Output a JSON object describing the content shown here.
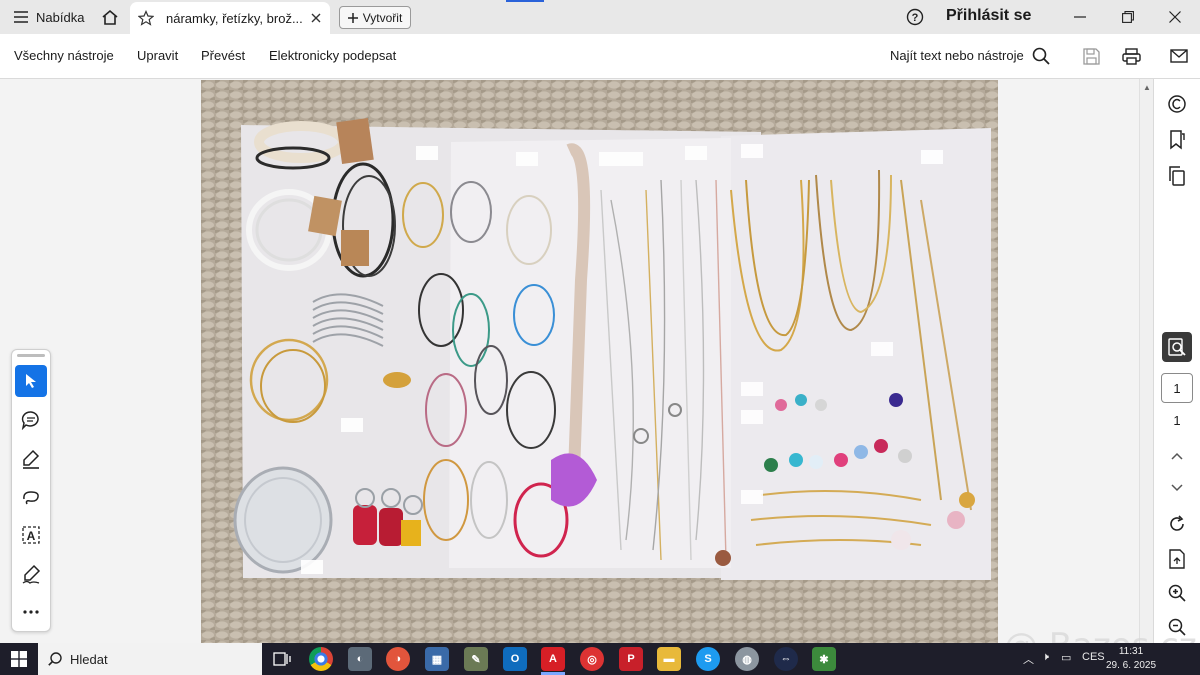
{
  "titlebar": {
    "menu_label": "Nabídka",
    "tab_title": "náramky, řetízky, brož...",
    "create_label": "Vytvořit",
    "signin_label": "Přihlásit se"
  },
  "toolbar": {
    "all_tools": "Všechny nástroje",
    "edit": "Upravit",
    "convert": "Převést",
    "sign": "Elektronicky podepsat",
    "find": "Najít text nebo nástroje"
  },
  "rail": {
    "current_page": "1",
    "total_pages": "1"
  },
  "taskbar": {
    "search_label": "Hledat",
    "language": "CES",
    "time": "11:31",
    "date": "29. 6. 2025"
  },
  "watermark": "@ Bazos.cz",
  "colors": {
    "accent": "#1473e6",
    "taskbar": "#1e1e2a",
    "acrobat_red": "#d71f26"
  },
  "icons": [
    "menu-icon",
    "home-icon",
    "star-icon",
    "close-icon",
    "plus-icon",
    "help-icon",
    "minimize-icon",
    "restore-icon",
    "close-window-icon",
    "search-icon",
    "save-icon",
    "print-icon",
    "mail-icon",
    "ai-assistant-icon",
    "bookmark-icon",
    "copy-pages-icon",
    "find-in-doc-icon",
    "chevron-up-icon",
    "chevron-down-icon",
    "rotate-icon",
    "page-fit-icon",
    "zoom-in-icon",
    "zoom-out-icon",
    "select-icon",
    "comment-icon",
    "highlight-icon",
    "draw-icon",
    "text-select-icon",
    "fill-sign-icon",
    "more-icon"
  ]
}
